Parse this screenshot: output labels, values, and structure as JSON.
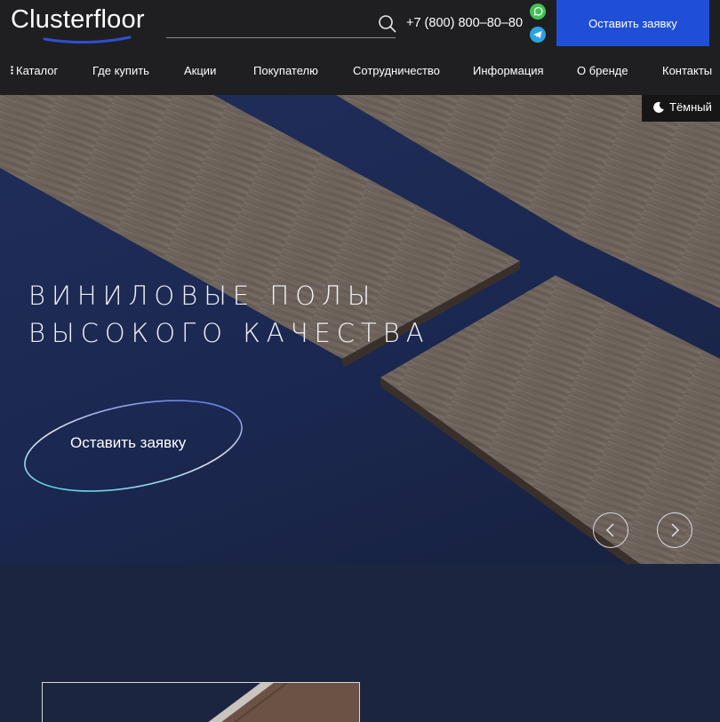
{
  "header": {
    "logo_text": "Clusterfloor",
    "phone": "+7 (800) 800–80–80",
    "cta_label": "Оставить заявку"
  },
  "nav": {
    "items": [
      {
        "label": "Каталог"
      },
      {
        "label": "Где купить"
      },
      {
        "label": "Акции"
      },
      {
        "label": "Покупателю"
      },
      {
        "label": "Сотрудничество"
      },
      {
        "label": "Информация"
      },
      {
        "label": "О бренде"
      },
      {
        "label": "Контакты"
      }
    ]
  },
  "theme_toggle": {
    "label": "Тёмный"
  },
  "hero": {
    "title_line1": "Виниловые полы",
    "title_line2": "высокого качества",
    "cta_label": "Оставить заявку"
  },
  "icons": {
    "search": "search-icon",
    "whatsapp": "whatsapp-icon",
    "telegram": "telegram-icon",
    "moon": "moon-icon",
    "prev": "chevron-left-icon",
    "next": "chevron-right-icon"
  },
  "colors": {
    "header_bg": "#1f1f22",
    "accent_blue": "#1f4fd6",
    "hero_bg": "#1b2851",
    "board_wood": "#6e635b"
  }
}
